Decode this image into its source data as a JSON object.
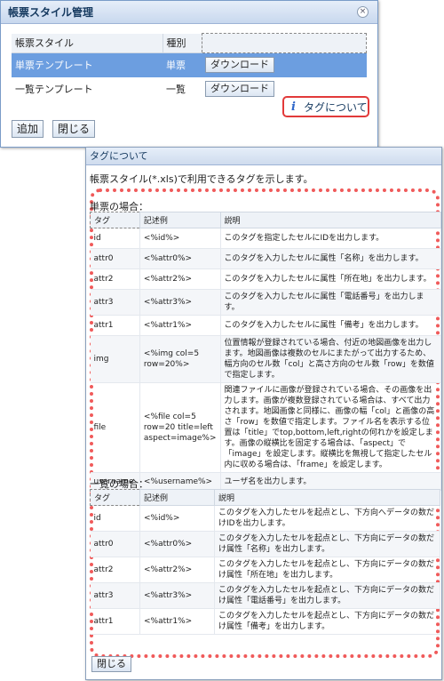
{
  "dialog1": {
    "title": "帳票スタイル管理",
    "close_glyph": "×",
    "columns": [
      "帳票スタイル",
      "種別"
    ],
    "rows": [
      {
        "style": "単票テンプレート",
        "type": "単票",
        "button": "ダウンロード"
      },
      {
        "style": "一覧テンプレート",
        "type": "一覧",
        "button": "ダウンロード"
      }
    ],
    "tag_link": "タグについて",
    "info_glyph": "i",
    "add_button": "追加",
    "close_button": "閉じる"
  },
  "dialog2": {
    "title": "タグについて",
    "description": "帳票スタイル(*.xls)で利用できるタグを示します。",
    "single_label": "単票の場合：",
    "list_label": "一覧の場合：",
    "columns": [
      "タグ",
      "記述例",
      "説明"
    ],
    "single_rows": [
      {
        "tag": "id",
        "example": "<%id%>",
        "desc": "このタグを指定したセルにIDを出力します。"
      },
      {
        "tag": "attr0",
        "example": "<%attr0%>",
        "desc": "このタグを入力したセルに属性「名称」を出力します。"
      },
      {
        "tag": "attr2",
        "example": "<%attr2%>",
        "desc": "このタグを入力したセルに属性「所在地」を出力します。"
      },
      {
        "tag": "attr3",
        "example": "<%attr3%>",
        "desc": "このタグを入力したセルに属性「電話番号」を出力します。"
      },
      {
        "tag": "attr1",
        "example": "<%attr1%>",
        "desc": "このタグを入力したセルに属性「備考」を出力します。"
      },
      {
        "tag": "img",
        "example": "<%img col=5 row=20%>",
        "desc": "位置情報が登録されている場合、付近の地図画像を出力します。地図画像は複数のセルにまたがって出力するため、幅方向のセル数「col」と高さ方向のセル数「row」を数値で指定します。"
      },
      {
        "tag": "file",
        "example": "<%file col=5 row=20 title=left aspect=image%>",
        "desc": "関連ファイルに画像が登録されている場合、その画像を出力します。画像が複数登録されている場合は、すべて出力されます。地図画像と同様に、画像の幅「col」と画像の高さ「row」を数値で指定します。ファイル名を表示する位置は「title」でtop,bottom,left,rightの何れかを設定します。画像の縦横比を固定する場合は、「aspect」で「image」を設定します。縦横比を無視して指定したセル内に収める場合は、「frame」を設定します。"
      },
      {
        "tag": "username",
        "example": "<%username%>",
        "desc": "ユーザ名を出力します。"
      }
    ],
    "list_rows": [
      {
        "tag": "id",
        "example": "<%id%>",
        "desc": "このタグを入力したセルを起点とし、下方向へデータの数だけIDを出力します。"
      },
      {
        "tag": "attr0",
        "example": "<%attr0%>",
        "desc": "このタグを入力したセルを起点とし、下方向にデータの数だけ属性「名称」を出力します。"
      },
      {
        "tag": "attr2",
        "example": "<%attr2%>",
        "desc": "このタグを入力したセルを起点とし、下方向にデータの数だけ属性「所在地」を出力します。"
      },
      {
        "tag": "attr3",
        "example": "<%attr3%>",
        "desc": "このタグを入力したセルを起点とし、下方向にデータの数だけ属性「電話番号」を出力します。"
      },
      {
        "tag": "attr1",
        "example": "<%attr1%>",
        "desc": "このタグを入力したセルを起点とし、下方向にデータの数だけ属性「備考」を出力します。"
      }
    ],
    "close_button": "閉じる"
  }
}
